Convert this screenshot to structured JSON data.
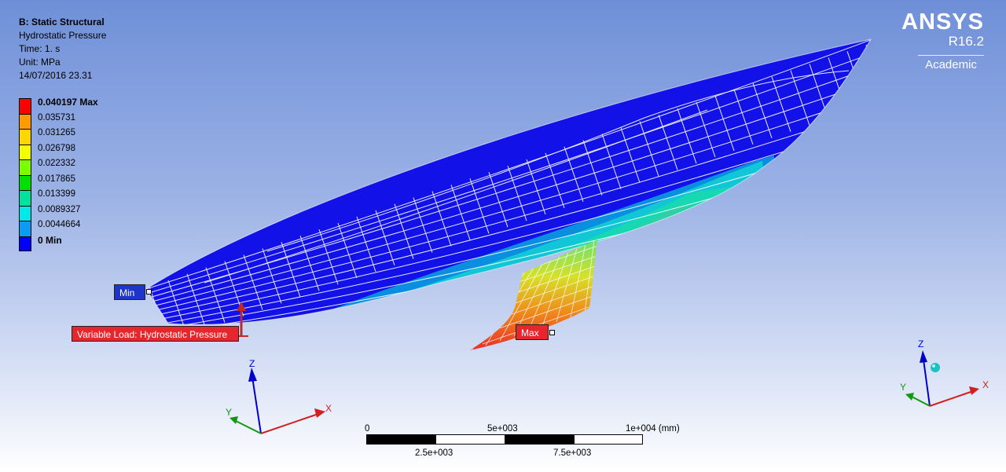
{
  "info": {
    "analysis": "B: Static Structural",
    "result": "Hydrostatic Pressure",
    "time": "Time: 1. s",
    "unit": "Unit: MPa",
    "date": "14/07/2016 23.31"
  },
  "legend": {
    "levels": [
      {
        "label": "0.040197 Max",
        "color": "#ff0000",
        "bold": true
      },
      {
        "label": "0.035731",
        "color": "#ff9a00",
        "bold": false
      },
      {
        "label": "0.031265",
        "color": "#ffd700",
        "bold": false
      },
      {
        "label": "0.026798",
        "color": "#f2ff00",
        "bold": false
      },
      {
        "label": "0.022332",
        "color": "#7aff00",
        "bold": false
      },
      {
        "label": "0.017865",
        "color": "#00e000",
        "bold": false
      },
      {
        "label": "0.013399",
        "color": "#00e29a",
        "bold": false
      },
      {
        "label": "0.0089327",
        "color": "#00e8e8",
        "bold": false
      },
      {
        "label": "0.0044664",
        "color": "#0a9cf0",
        "bold": false
      },
      {
        "label": "0 Min",
        "color": "#0000ff",
        "bold": true
      }
    ]
  },
  "brand": {
    "name": "ANSYS",
    "version": "R16.2",
    "edition": "Academic"
  },
  "probes": {
    "min": "Min",
    "max": "Max",
    "load": "Variable Load: Hydrostatic Pressure"
  },
  "triad": {
    "x": "X",
    "y": "Y",
    "z": "Z"
  },
  "scale_bar": {
    "top_labels": [
      "0",
      "5e+003",
      "1e+004 (mm)"
    ],
    "bottom_labels": [
      "2.5e+003",
      "7.5e+003"
    ]
  },
  "colors": {
    "mesh_line": "#ffffff",
    "background_top": "#6e8fd8",
    "background_bottom": "#ffffff"
  }
}
